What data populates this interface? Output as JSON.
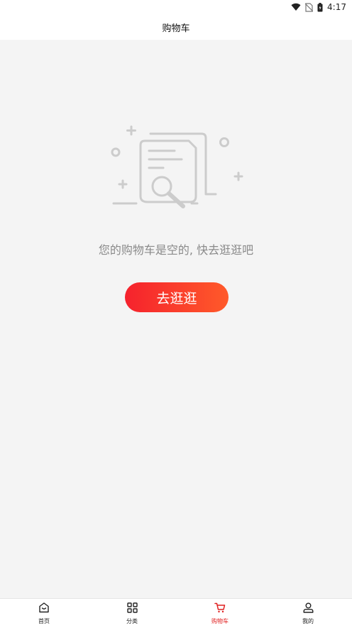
{
  "status_bar": {
    "time": "4:17",
    "icons": [
      "wifi-icon",
      "no-sim-icon",
      "battery-icon"
    ]
  },
  "header": {
    "title": "购物车"
  },
  "empty_state": {
    "icon": "empty-cart-document-search-icon",
    "message": "您的购物车是空的, 快去逛逛吧",
    "button_label": "去逛逛"
  },
  "bottom_nav": {
    "items": [
      {
        "label": "首页",
        "icon": "home-icon",
        "active": false
      },
      {
        "label": "分类",
        "icon": "category-grid-icon",
        "active": false
      },
      {
        "label": "购物车",
        "icon": "cart-icon",
        "active": true
      },
      {
        "label": "我的",
        "icon": "user-icon",
        "active": false
      }
    ]
  },
  "colors": {
    "accent": "#f5222d",
    "accent_gradient_end": "#ff5a2a",
    "active_nav": "#e02020",
    "background": "#f4f4f4"
  }
}
